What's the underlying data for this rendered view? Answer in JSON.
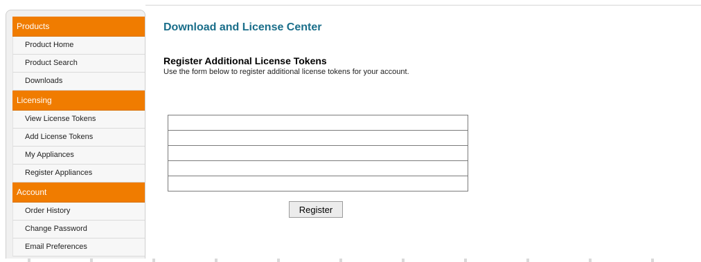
{
  "sidebar": {
    "sections": [
      {
        "title": "Products",
        "items": [
          "Product Home",
          "Product Search",
          "Downloads"
        ]
      },
      {
        "title": "Licensing",
        "items": [
          "View License Tokens",
          "Add License Tokens",
          "My Appliances",
          "Register Appliances"
        ]
      },
      {
        "title": "Account",
        "items": [
          "Order History",
          "Change Password",
          "Email Preferences"
        ]
      }
    ]
  },
  "main": {
    "page_title": "Download and License Center",
    "form_heading": "Register Additional License Tokens",
    "form_description": "Use the form below to register additional license tokens for your account.",
    "token_fields": [
      "",
      "",
      "",
      "",
      ""
    ],
    "register_label": "Register"
  },
  "colors": {
    "section_header_bg": "#f07c00",
    "title_color": "#1a6e8a"
  }
}
